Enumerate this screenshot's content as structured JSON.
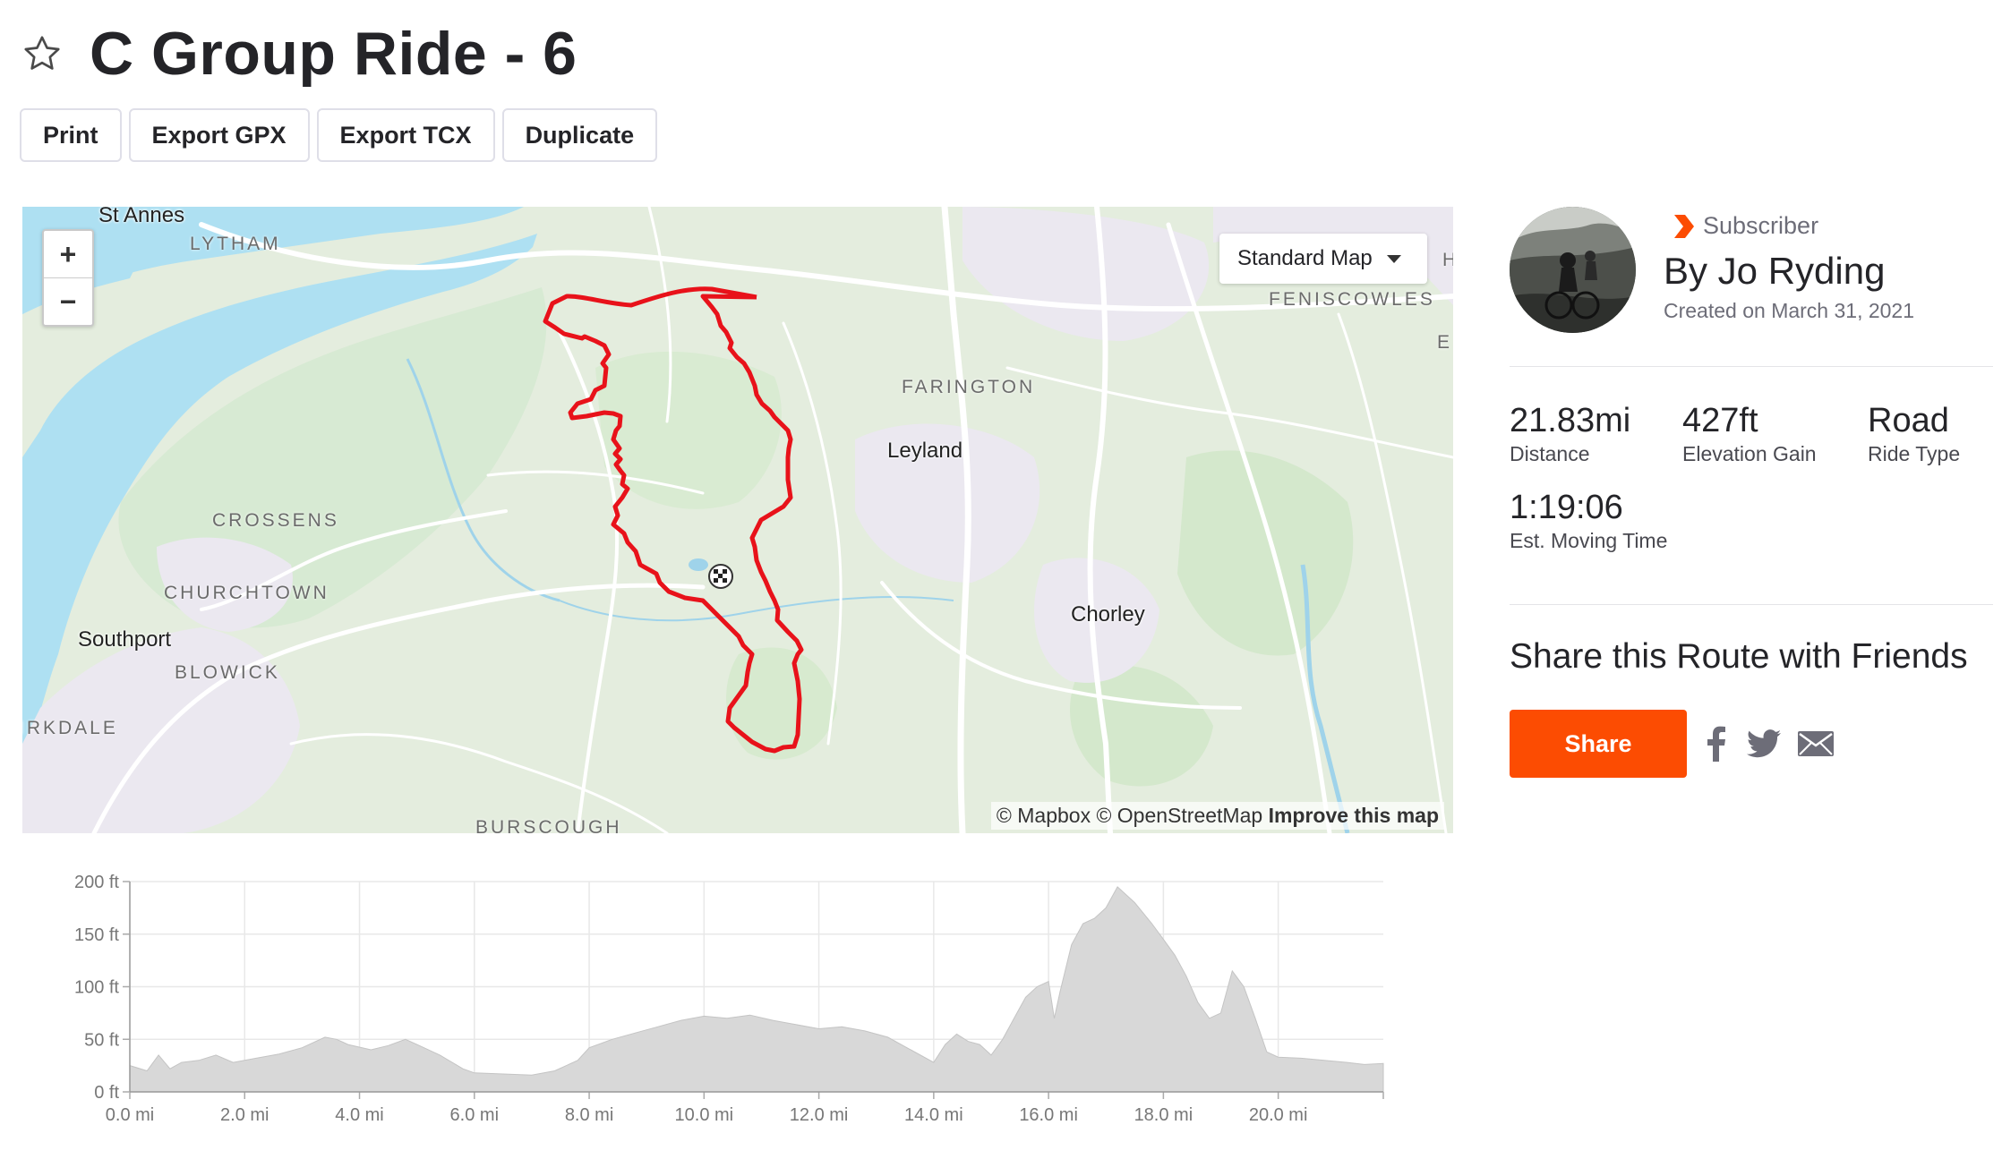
{
  "page": {
    "title": "C Group Ride - 6"
  },
  "icons": {
    "favorite": "star-outline-icon",
    "subscriber": "strava-chevron-icon",
    "facebook": "facebook-icon",
    "twitter": "twitter-icon",
    "email": "email-icon",
    "start": "checkered-flag-icon"
  },
  "actions": {
    "print": "Print",
    "export_gpx": "Export GPX",
    "export_tcx": "Export TCX",
    "duplicate": "Duplicate"
  },
  "map": {
    "style_selector": "Standard Map",
    "zoom_in": "+",
    "zoom_out": "−",
    "attribution": "© Mapbox © OpenStreetMap",
    "attribution_link": "Improve this map",
    "labels": {
      "st_annes": "St Annes",
      "lytham": "LYTHAM",
      "feniscowles": "FENISCOWLES",
      "farington": "FARINGTON",
      "leyland": "Leyland",
      "crossens": "CROSSENS",
      "churchtown": "CHURCHTOWN",
      "southport": "Southport",
      "blowick": "BLOWICK",
      "birkdale": "IRKDALE",
      "chorley": "Chorley",
      "burscough": "BURSCOUGH",
      "h_partial": "H",
      "e_partial": "E"
    },
    "colors": {
      "route": "#e8121a",
      "water": "#aee0f2",
      "land": "#e6eee1"
    }
  },
  "profile": {
    "subscriber_label": "Subscriber",
    "author": "By Jo Ryding",
    "created": "Created on March 31, 2021"
  },
  "stats": {
    "distance": {
      "value": "21.83mi",
      "label": "Distance"
    },
    "elevation": {
      "value": "427ft",
      "label": "Elevation Gain"
    },
    "ride_type": {
      "value": "Road",
      "label": "Ride Type"
    },
    "moving_time": {
      "value": "1:19:06",
      "label": "Est. Moving Time"
    }
  },
  "share": {
    "heading": "Share this Route with Friends",
    "button": "Share"
  },
  "colors": {
    "accent": "#fc4c02",
    "text": "#242428",
    "muted": "#6d6d78",
    "elevation_fill": "#d8d8d8"
  },
  "chart_data": {
    "type": "area",
    "title": "",
    "xlabel": "",
    "ylabel": "",
    "xlim": [
      0,
      21.83
    ],
    "ylim": [
      0,
      200
    ],
    "x_ticks": [
      "0.0 mi",
      "2.0 mi",
      "4.0 mi",
      "6.0 mi",
      "8.0 mi",
      "10.0 mi",
      "12.0 mi",
      "14.0 mi",
      "16.0 mi",
      "18.0 mi",
      "20.0 mi"
    ],
    "y_ticks": [
      "0 ft",
      "50 ft",
      "100 ft",
      "150 ft",
      "200 ft"
    ],
    "grid": true,
    "series": [
      {
        "x": [
          0,
          0.3,
          0.5,
          0.7,
          0.9,
          1.2,
          1.5,
          1.8,
          2.2,
          2.6,
          3.0,
          3.4,
          3.6,
          3.8,
          4.2,
          4.5,
          4.8,
          5.0,
          5.4,
          5.8,
          6.0,
          6.5,
          7.0,
          7.4,
          7.8,
          8.0,
          8.4,
          8.8,
          9.2,
          9.6,
          10.0,
          10.4,
          10.8,
          11.2,
          11.6,
          12.0,
          12.4,
          12.8,
          13.2,
          13.6,
          14.0,
          14.2,
          14.4,
          14.6,
          14.8,
          15.0,
          15.2,
          15.4,
          15.6,
          15.8,
          16.0,
          16.1,
          16.2,
          16.4,
          16.6,
          16.8,
          17.0,
          17.2,
          17.5,
          17.8,
          18.0,
          18.2,
          18.4,
          18.6,
          18.8,
          19.0,
          19.2,
          19.4,
          19.6,
          19.8,
          20.0,
          20.4,
          20.8,
          21.2,
          21.5,
          21.83
        ],
        "y": [
          25,
          20,
          35,
          22,
          28,
          30,
          35,
          28,
          32,
          36,
          42,
          52,
          50,
          45,
          40,
          44,
          50,
          45,
          35,
          22,
          18,
          17,
          16,
          20,
          30,
          42,
          50,
          56,
          62,
          68,
          72,
          70,
          73,
          68,
          64,
          60,
          62,
          58,
          52,
          40,
          28,
          45,
          55,
          48,
          45,
          35,
          50,
          70,
          90,
          100,
          105,
          70,
          95,
          140,
          160,
          165,
          175,
          195,
          180,
          160,
          145,
          130,
          110,
          85,
          70,
          75,
          115,
          100,
          70,
          38,
          33,
          32,
          30,
          28,
          26,
          27
        ]
      }
    ]
  }
}
